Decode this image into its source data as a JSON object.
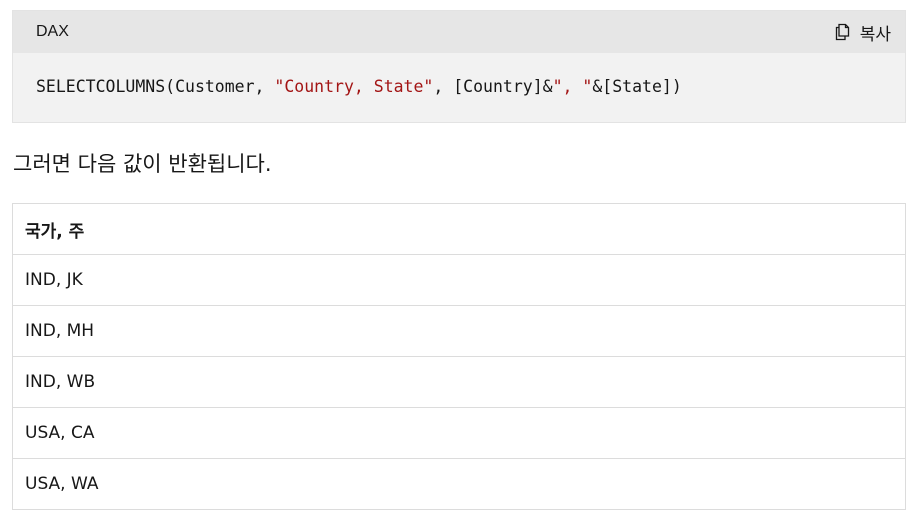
{
  "code_block": {
    "language": "DAX",
    "copy_label": "복사",
    "code": {
      "fn": "SELECTCOLUMNS(Customer, ",
      "str1": "\"Country, State\"",
      "mid": ", [Country]&",
      "str2": "\", \"",
      "end": "&[State])"
    }
  },
  "paragraph": "그러면 다음 값이 반환됩니다.",
  "table": {
    "header": "국가, 주",
    "rows": [
      "IND, JK",
      "IND, MH",
      "IND, WB",
      "USA, CA",
      "USA, WA"
    ]
  },
  "colors": {
    "string": "#a31515",
    "header_bg": "#e6e6e6",
    "code_bg": "#f2f2f2"
  }
}
